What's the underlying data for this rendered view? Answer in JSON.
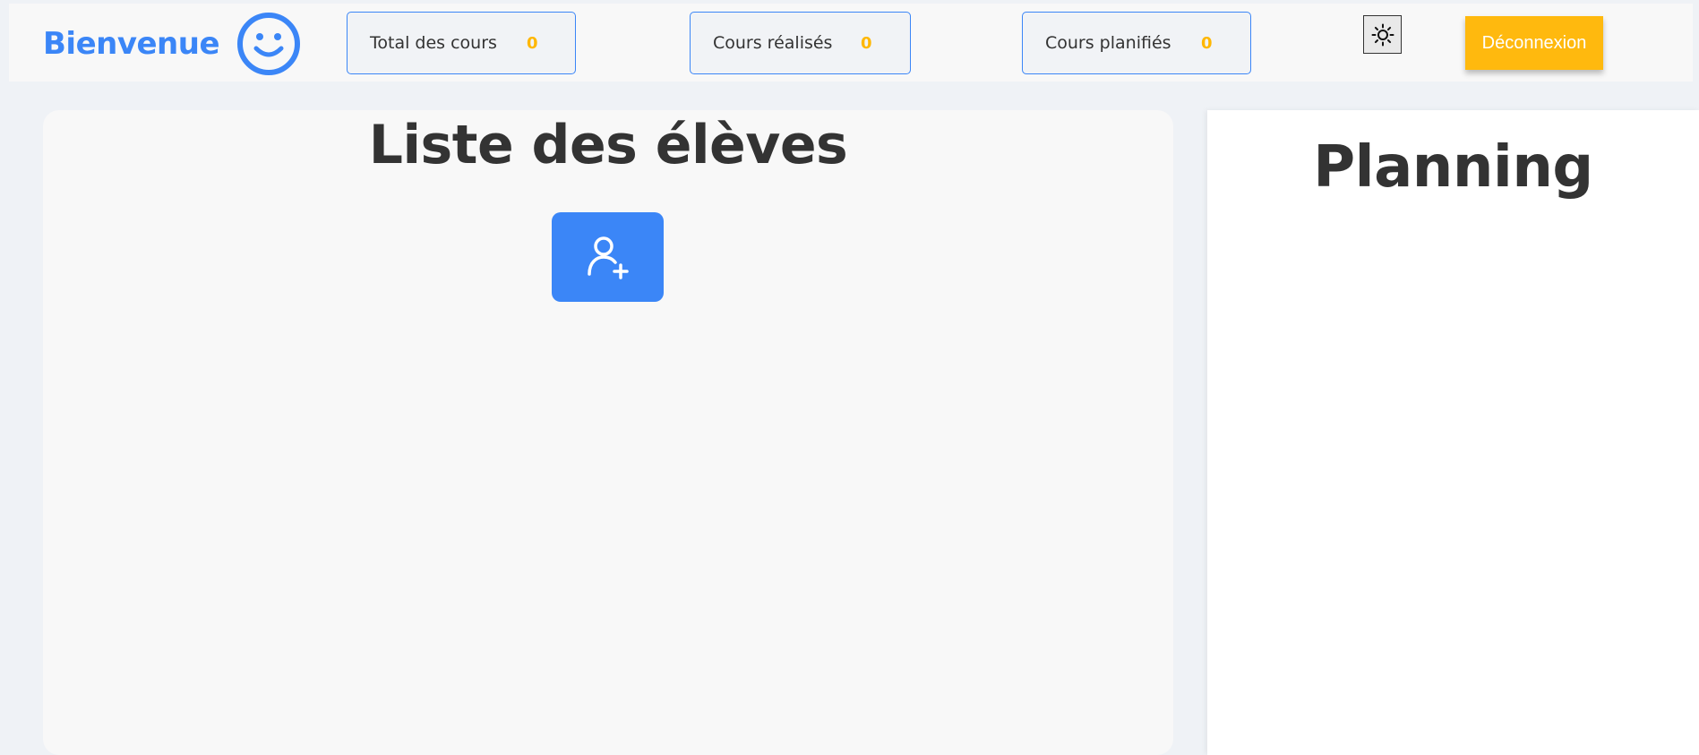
{
  "header": {
    "brand_title": "Bienvenue",
    "brand_icon": "smiley-icon",
    "accent_color": "#3b86f7",
    "stats": [
      {
        "label": "Total des cours",
        "value": "0"
      },
      {
        "label": "Cours réalisés",
        "value": "0"
      },
      {
        "label": "Cours planifiés",
        "value": "0"
      }
    ],
    "stat_value_color": "#ffb700",
    "theme_toggle_icon": "sun-icon",
    "logout_label": "Déconnexion",
    "logout_color": "#ffb90e"
  },
  "students": {
    "title": "Liste des élèves",
    "add_icon": "add-user-icon"
  },
  "planning": {
    "title": "Planning"
  }
}
